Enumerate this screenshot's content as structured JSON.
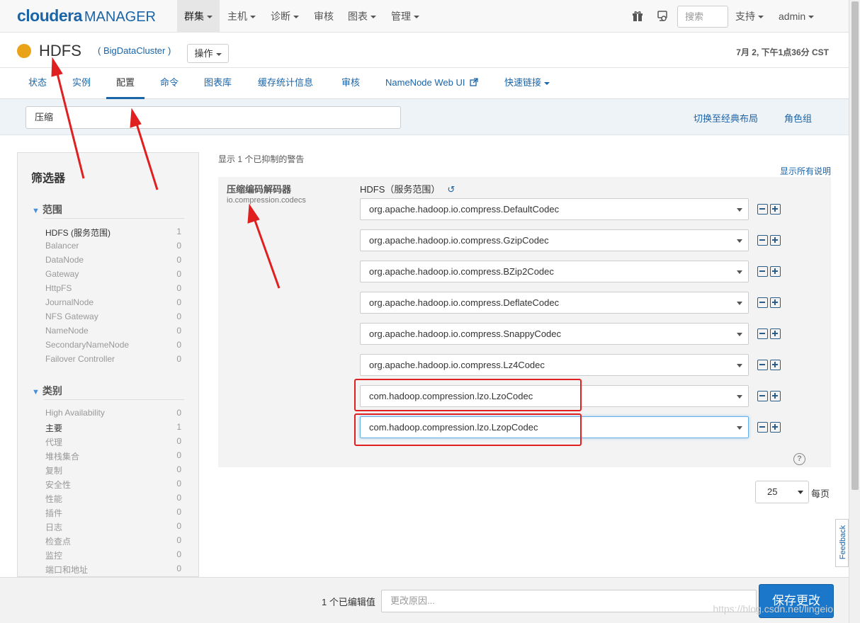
{
  "brand": {
    "name": "cloudera",
    "product": "MANAGER"
  },
  "topnav": {
    "items": [
      {
        "label": "群集"
      },
      {
        "label": "主机"
      },
      {
        "label": "诊断"
      },
      {
        "label": "审核"
      },
      {
        "label": "图表"
      },
      {
        "label": "管理"
      }
    ],
    "search_placeholder": "搜索",
    "support_label": "支持",
    "user_label": "admin",
    "icons": [
      "gift-icon",
      "user-monitor-icon"
    ]
  },
  "service": {
    "name": "HDFS",
    "cluster": "( BigDataCluster )",
    "actions_label": "操作",
    "timestamp": "7月 2, 下午1点36分 CST",
    "status_color": "#e8a317"
  },
  "tabs": [
    {
      "label": "状态"
    },
    {
      "label": "实例"
    },
    {
      "label": "配置"
    },
    {
      "label": "命令"
    },
    {
      "label": "图表库"
    },
    {
      "label": "缓存统计信息"
    },
    {
      "label": "审核"
    },
    {
      "label": "NameNode Web UI"
    },
    {
      "label": "快速链接"
    }
  ],
  "config_search": {
    "value": "压缩"
  },
  "strip_links": {
    "classic_layout": "切换至经典布局",
    "role_groups": "角色组"
  },
  "filters": {
    "title": "筛选器",
    "scope": {
      "title": "范围",
      "items": [
        {
          "label": "HDFS (服务范围)",
          "count": "1"
        },
        {
          "label": "Balancer",
          "count": "0"
        },
        {
          "label": "DataNode",
          "count": "0"
        },
        {
          "label": "Gateway",
          "count": "0"
        },
        {
          "label": "HttpFS",
          "count": "0"
        },
        {
          "label": "JournalNode",
          "count": "0"
        },
        {
          "label": "NFS Gateway",
          "count": "0"
        },
        {
          "label": "NameNode",
          "count": "0"
        },
        {
          "label": "SecondaryNameNode",
          "count": "0"
        },
        {
          "label": "Failover Controller",
          "count": "0"
        }
      ]
    },
    "category": {
      "title": "类别",
      "items": [
        {
          "label": "High Availability",
          "count": "0"
        },
        {
          "label": "主要",
          "count": "1"
        },
        {
          "label": "代理",
          "count": "0"
        },
        {
          "label": "堆栈集合",
          "count": "0"
        },
        {
          "label": "复制",
          "count": "0"
        },
        {
          "label": "安全性",
          "count": "0"
        },
        {
          "label": "性能",
          "count": "0"
        },
        {
          "label": "插件",
          "count": "0"
        },
        {
          "label": "日志",
          "count": "0"
        },
        {
          "label": "检查点",
          "count": "0"
        },
        {
          "label": "监控",
          "count": "0"
        },
        {
          "label": "端口和地址",
          "count": "0"
        }
      ]
    }
  },
  "main": {
    "suppressed_note": "显示 1 个已抑制的警告",
    "show_all_desc": "显示所有说明",
    "property": {
      "display_name": "压缩编码解码器",
      "key": "io.compression.codecs",
      "scope_label": "HDFS（服务范围）",
      "values": [
        "org.apache.hadoop.io.compress.DefaultCodec",
        "org.apache.hadoop.io.compress.GzipCodec",
        "org.apache.hadoop.io.compress.BZip2Codec",
        "org.apache.hadoop.io.compress.DeflateCodec",
        "org.apache.hadoop.io.compress.SnappyCodec",
        "org.apache.hadoop.io.compress.Lz4Codec",
        "com.hadoop.compression.lzo.LzoCodec",
        "com.hadoop.compression.lzo.LzopCodec"
      ]
    },
    "page_size": "25",
    "per_page_label": "每页"
  },
  "feedback_label": "Feedback",
  "bottom": {
    "edited_count": "1 个已编辑值",
    "reason_placeholder": "更改原因...",
    "save_label": "保存更改",
    "watermark": "https://blog.csdn.net/lingeio"
  },
  "colors": {
    "link": "#1a64a8",
    "annotation": "#e02020",
    "save": "#1a77c9"
  }
}
